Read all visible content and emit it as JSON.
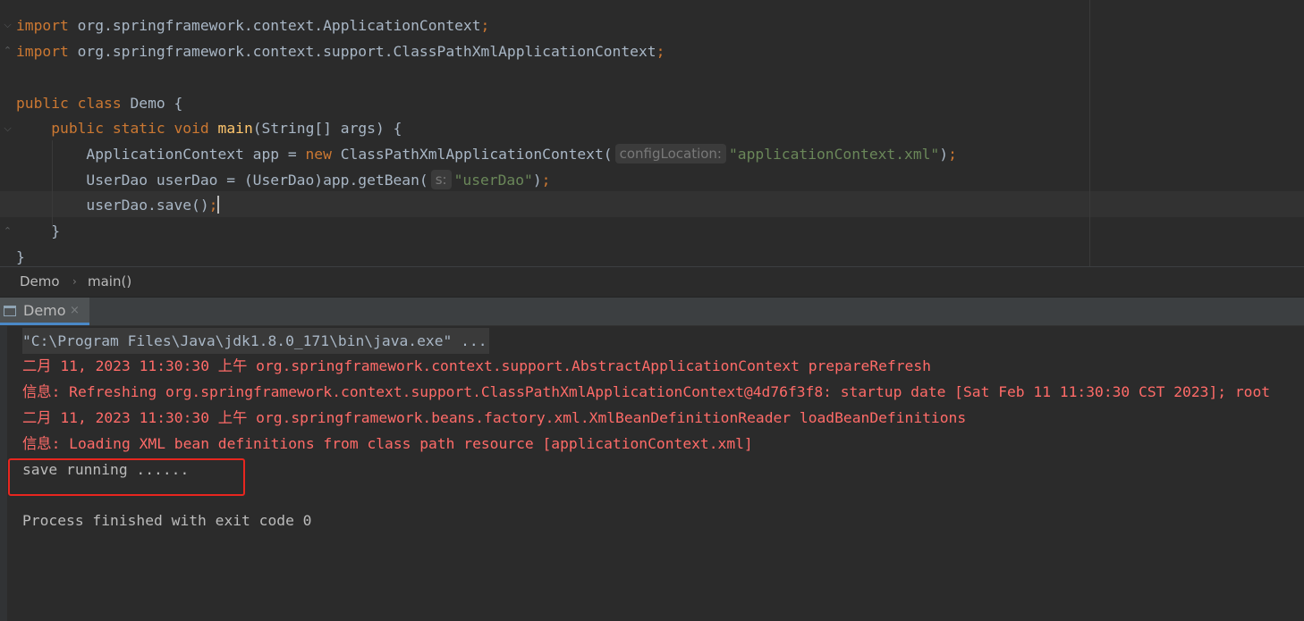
{
  "editor": {
    "lines": {
      "import1": {
        "kw": "import",
        "text": " org.springframework.context.ApplicationContext",
        "semi": ";"
      },
      "import2": {
        "kw": "import",
        "text": " org.springframework.context.support.ClassPathXmlApplicationContext",
        "semi": ";"
      },
      "class_decl": {
        "kw1": "public",
        "kw2": "class",
        "name": " Demo {"
      },
      "main_decl": {
        "kw1": "public",
        "kw2": "static",
        "kw3": "void",
        "fn": "main",
        "params": "(String[] args) {"
      },
      "app_line": {
        "pre": "ApplicationContext app = ",
        "kw": "new",
        "call": " ClassPathXmlApplicationContext(",
        "hint": "configLocation:",
        "arg": "\"applicationContext.xml\"",
        "close": ")",
        "semi": ";"
      },
      "dao_line": {
        "pre": "UserDao userDao = (UserDao)app.getBean(",
        "hint": "s:",
        "arg": "\"userDao\"",
        "close": ")",
        "semi": ";"
      },
      "save_line": {
        "text": "userDao.save()",
        "semi": ";"
      },
      "close_method": "}",
      "close_class": "}"
    }
  },
  "breadcrumb": {
    "items": [
      "Demo",
      "main()"
    ],
    "separator": "›"
  },
  "run_window": {
    "tab_label": "Demo",
    "close_glyph": "×"
  },
  "console": {
    "lines": [
      {
        "kind": "cmd",
        "text": "\"C:\\Program Files\\Java\\jdk1.8.0_171\\bin\\java.exe\" ..."
      },
      {
        "kind": "err",
        "text": "二月 11, 2023 11:30:30 上午 org.springframework.context.support.AbstractApplicationContext prepareRefresh"
      },
      {
        "kind": "err",
        "text": "信息: Refreshing org.springframework.context.support.ClassPathXmlApplicationContext@4d76f3f8: startup date [Sat Feb 11 11:30:30 CST 2023]; root"
      },
      {
        "kind": "err",
        "text": "二月 11, 2023 11:30:30 上午 org.springframework.beans.factory.xml.XmlBeanDefinitionReader loadBeanDefinitions"
      },
      {
        "kind": "err",
        "text": "信息: Loading XML bean definitions from class path resource [applicationContext.xml]"
      },
      {
        "kind": "out",
        "text": "save running ......"
      },
      {
        "kind": "out",
        "text": ""
      },
      {
        "kind": "out",
        "text": "Process finished with exit code 0"
      }
    ]
  },
  "colors": {
    "background": "#2b2b2b",
    "keyword": "#cc7832",
    "function": "#ffc66d",
    "string": "#6a8759",
    "default_text": "#a9b7c6",
    "error_text": "#ff6b68",
    "highlight_box": "#e8261f",
    "tab_underline": "#4a88c7"
  }
}
